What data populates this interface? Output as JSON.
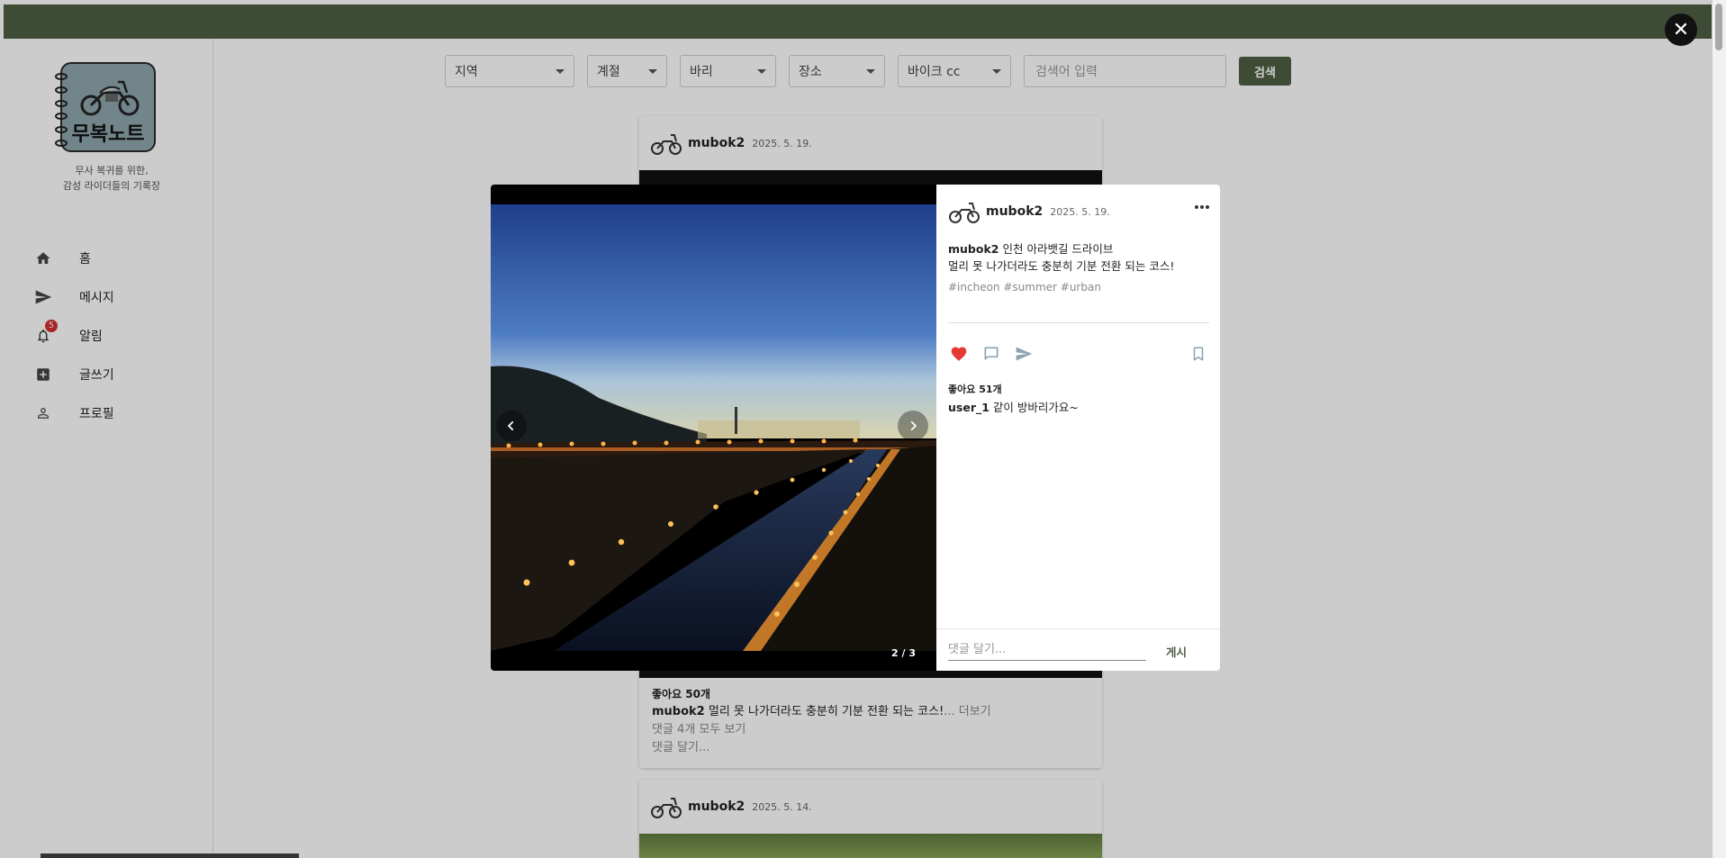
{
  "brand": {
    "logo_text": "무복노트",
    "tagline_line1": "무사 복귀를 위한,",
    "tagline_line2": "감성 라이더들의 기록장",
    "accent": "#4e5e43"
  },
  "sidebar": {
    "items": [
      {
        "label": "홈",
        "icon": "home-icon"
      },
      {
        "label": "메시지",
        "icon": "send-icon"
      },
      {
        "label": "알림",
        "icon": "bell-icon",
        "badge": "5"
      },
      {
        "label": "글쓰기",
        "icon": "add-box-icon"
      },
      {
        "label": "프로필",
        "icon": "person-icon"
      }
    ]
  },
  "filters": {
    "region": "지역",
    "season": "계절",
    "bari": "바리",
    "place": "장소",
    "bike_cc": "바이크 cc",
    "search_placeholder": "검색어 입력",
    "search_button": "검색"
  },
  "feed": {
    "post1": {
      "username": "mubok2",
      "date": "2025. 5. 19.",
      "likes": "좋아요 50개",
      "caption_user": "mubok2",
      "caption_text": "멀리 못 나가더라도 충분히 기분 전환 되는 코스!",
      "more": "... 더보기",
      "view_comments": "댓글 4개 모두 보기",
      "add_comment": "댓글 달기..."
    },
    "post2": {
      "username": "mubok2",
      "date": "2025. 5. 14."
    }
  },
  "modal": {
    "image_counter": "2 / 3",
    "username": "mubok2",
    "date": "2025. 5. 19.",
    "caption_user": "mubok2",
    "caption_title": "인천 아라뱃길 드라이브",
    "caption_body": "멀리 못 나가더라도 충분히 기분 전환 되는 코스!",
    "hashtags": "#incheon #summer #urban",
    "likes": "좋아요 51개",
    "comment_user": "user_1",
    "comment_text": "같이 방바리가요~",
    "comment_placeholder": "댓글 달기...",
    "post_button": "게시",
    "close": "✕",
    "liked": true,
    "like_color": "#e53935"
  }
}
